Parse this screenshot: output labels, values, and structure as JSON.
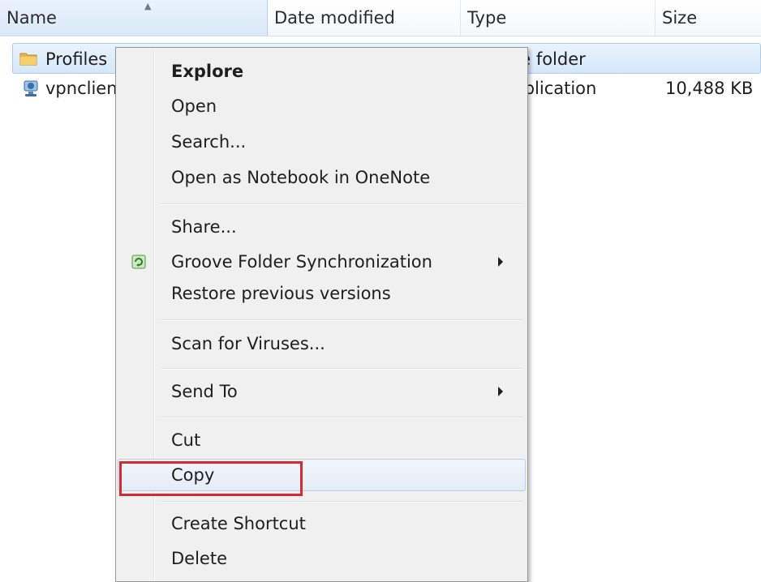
{
  "columns": {
    "name": "Name",
    "date_modified": "Date modified",
    "type": "Type",
    "size": "Size"
  },
  "files": [
    {
      "name": "Profiles",
      "type": "File folder",
      "size": "",
      "icon": "folder-icon"
    },
    {
      "name": "vpnclient",
      "type": "Application",
      "size": "10,488 KB",
      "icon": "vpn-app-icon"
    }
  ],
  "context_menu": {
    "items": [
      {
        "label": "Explore",
        "bold": true
      },
      {
        "label": "Open"
      },
      {
        "label": "Search..."
      },
      {
        "label": "Open as Notebook in OneNote"
      },
      {
        "label": "Share..."
      },
      {
        "label": "Groove Folder Synchronization",
        "submenu": true,
        "icon": "groove-icon"
      },
      {
        "label": "Restore previous versions"
      },
      {
        "label": "Scan for Viruses..."
      },
      {
        "label": "Send To",
        "submenu": true
      },
      {
        "label": "Cut"
      },
      {
        "label": "Copy",
        "hovered": true,
        "annotated": true
      },
      {
        "label": "Create Shortcut"
      },
      {
        "label": "Delete"
      }
    ]
  },
  "colors": {
    "selection_border": "#a9cbee",
    "menu_background": "#f0f0f0",
    "annotation_red": "#d8292f"
  }
}
